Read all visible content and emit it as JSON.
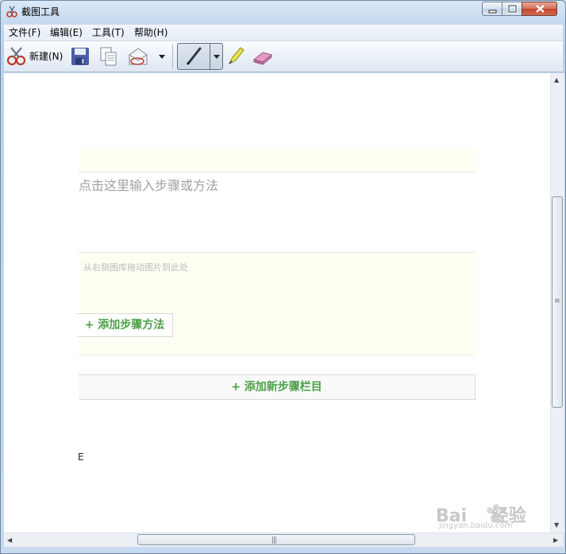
{
  "window": {
    "title": "截图工具"
  },
  "menu": {
    "items": [
      "文件(F)",
      "编辑(E)",
      "工具(T)",
      "帮助(H)"
    ]
  },
  "toolbar": {
    "new_label": "新建(N)"
  },
  "page": {
    "step_placeholder": "点击这里输入步骤或方法",
    "drag_hint": "从右侧图库拖动图片到此处",
    "add_method": "+ 添加步骤方法",
    "add_new_step": "+ 添加新步骤栏目",
    "cut_char": "E"
  },
  "watermark": {
    "brand": "Bai",
    "brand_cn": "经验",
    "url": "jingyan.baidu.com"
  },
  "colors": {
    "accent_green": "#4aa047",
    "note_bg": "#fefef2",
    "window_frame": "#c5d8ee"
  }
}
